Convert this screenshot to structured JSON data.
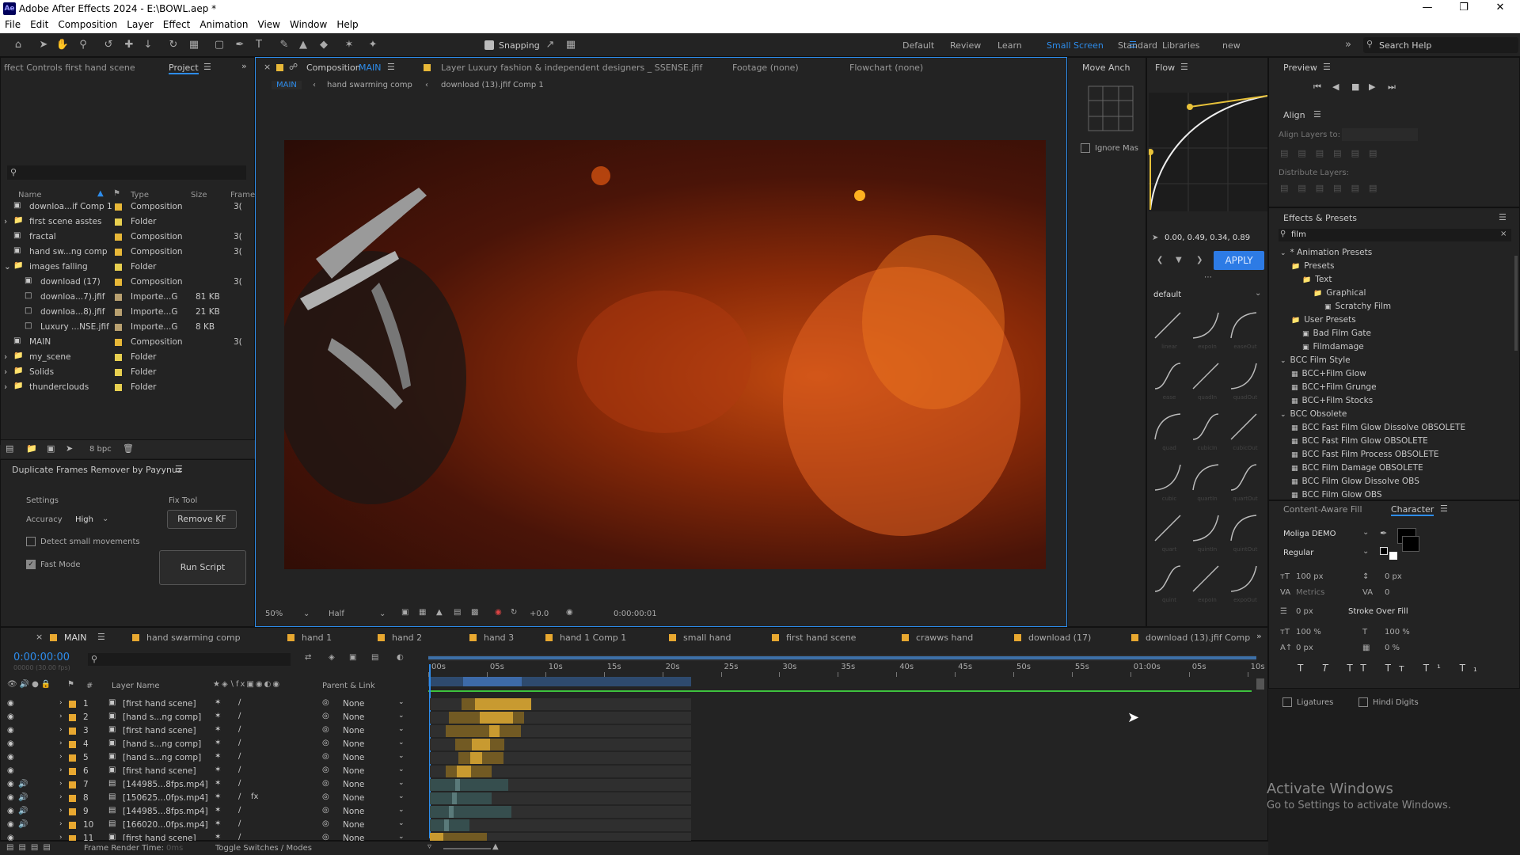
{
  "app": {
    "title": "Adobe After Effects 2024 - E:\\BOWL.aep *",
    "logo": "Ae"
  },
  "menu": [
    "File",
    "Edit",
    "Composition",
    "Layer",
    "Effect",
    "Animation",
    "View",
    "Window",
    "Help"
  ],
  "toolbar": {
    "snapping": "Snapping",
    "workspaces": [
      "Default",
      "Review",
      "Learn",
      "Small Screen",
      "Standard",
      "Libraries",
      "new"
    ],
    "active_workspace": "Small Screen",
    "search_placeholder": "Search Help"
  },
  "project": {
    "effect_controls_tab": "ffect Controls first hand scene",
    "project_tab": "Project",
    "columns": [
      "Name",
      "Type",
      "Size",
      "Frame"
    ],
    "items": [
      {
        "name": "downloa...if Comp 1",
        "type": "Composition",
        "size": "",
        "frame": "3(",
        "color": "#e8b838",
        "icon": "comp",
        "indent": 0,
        "twirl": ""
      },
      {
        "name": "first scene asstes",
        "type": "Folder",
        "size": "",
        "frame": "",
        "color": "#e8d050",
        "icon": "folder",
        "indent": 0,
        "twirl": "›"
      },
      {
        "name": "fractal",
        "type": "Composition",
        "size": "",
        "frame": "3(",
        "color": "#e8b838",
        "icon": "comp",
        "indent": 0,
        "twirl": ""
      },
      {
        "name": "hand sw...ng comp",
        "type": "Composition",
        "size": "",
        "frame": "3(",
        "color": "#e8b838",
        "icon": "comp",
        "indent": 0,
        "twirl": ""
      },
      {
        "name": "images falling",
        "type": "Folder",
        "size": "",
        "frame": "",
        "color": "#e8d050",
        "icon": "folder",
        "indent": 0,
        "twirl": "⌄"
      },
      {
        "name": "download (17)",
        "type": "Composition",
        "size": "",
        "frame": "3(",
        "color": "#e8b838",
        "icon": "comp",
        "indent": 1,
        "twirl": ""
      },
      {
        "name": "downloa...7).jfif",
        "type": "Importe...G",
        "size": "81 KB",
        "frame": "",
        "color": "#b8a070",
        "icon": "file",
        "indent": 1,
        "twirl": ""
      },
      {
        "name": "downloa...8).jfif",
        "type": "Importe...G",
        "size": "21 KB",
        "frame": "",
        "color": "#b8a070",
        "icon": "file",
        "indent": 1,
        "twirl": ""
      },
      {
        "name": "Luxury ...NSE.jfif",
        "type": "Importe...G",
        "size": "8 KB",
        "frame": "",
        "color": "#b8a070",
        "icon": "file",
        "indent": 1,
        "twirl": ""
      },
      {
        "name": "MAIN",
        "type": "Composition",
        "size": "",
        "frame": "3(",
        "color": "#e8b838",
        "icon": "comp",
        "indent": 0,
        "twirl": ""
      },
      {
        "name": "my_scene",
        "type": "Folder",
        "size": "",
        "frame": "",
        "color": "#e8d050",
        "icon": "folder",
        "indent": 0,
        "twirl": "›"
      },
      {
        "name": "Solids",
        "type": "Folder",
        "size": "",
        "frame": "",
        "color": "#e8d050",
        "icon": "folder",
        "indent": 0,
        "twirl": "›"
      },
      {
        "name": "thunderclouds",
        "type": "Folder",
        "size": "",
        "frame": "",
        "color": "#e8d050",
        "icon": "folder",
        "indent": 0,
        "twirl": "›"
      }
    ],
    "bpc": "8 bpc"
  },
  "dup": {
    "title": "Duplicate Frames Remover by Payynuz",
    "settings": "Settings",
    "accuracy_label": "Accuracy",
    "accuracy_value": "High",
    "detect": "Detect small movements",
    "fast": "Fast Mode",
    "fix_tool": "Fix Tool",
    "remove_kf": "Remove KF",
    "run": "Run Script"
  },
  "comp": {
    "tab_label": "Composition",
    "tab_name": "MAIN",
    "layer_tab": "Layer  Luxury fashion & independent designers _ SSENSE.jfif",
    "footage_tab": "Footage (none)",
    "flowchart_tab": "Flowchart (none)",
    "breadcrumbs": [
      "MAIN",
      "hand swarming comp",
      "download (13).jfif Comp 1"
    ],
    "zoom": "50%",
    "resolution": "Half",
    "exposure": "+0.0",
    "timecode": "0:00:00:01"
  },
  "move_anchor": {
    "title": "Move Anch",
    "ignore": "Ignore Mas"
  },
  "flow": {
    "title": "Flow",
    "values": "0.00, 0.49, 0.34, 0.89",
    "apply": "APPLY",
    "preset": "default",
    "curves": [
      "linear",
      "expoIn",
      "easeOut",
      "ease",
      "quadIn",
      "quadOut",
      "quad",
      "cubicIn",
      "cubicOut",
      "cubic",
      "quartIn",
      "quartOut",
      "quart",
      "quintIn",
      "quintOut",
      "quint",
      "expoIn",
      "expoOut"
    ]
  },
  "preview": {
    "title": "Preview"
  },
  "align": {
    "title": "Align",
    "align_to": "Align Layers to:",
    "distribute": "Distribute Layers:"
  },
  "effects": {
    "title": "Effects & Presets",
    "search": "film",
    "tree": [
      {
        "t": "* Animation Presets",
        "d": 0,
        "k": "tw"
      },
      {
        "t": "Presets",
        "d": 1,
        "k": "folder"
      },
      {
        "t": "Text",
        "d": 2,
        "k": "folder"
      },
      {
        "t": "Graphical",
        "d": 3,
        "k": "folder"
      },
      {
        "t": "Scratchy Film",
        "d": 4,
        "k": "item"
      },
      {
        "t": "User Presets",
        "d": 1,
        "k": "folder"
      },
      {
        "t": "Bad Film Gate",
        "d": 2,
        "k": "item"
      },
      {
        "t": "Filmdamage",
        "d": 2,
        "k": "item"
      },
      {
        "t": "BCC Film Style",
        "d": 0,
        "k": "tw"
      },
      {
        "t": "BCC+Film Glow",
        "d": 1,
        "k": "fx"
      },
      {
        "t": "BCC+Film Grunge",
        "d": 1,
        "k": "fx"
      },
      {
        "t": "BCC+Film Stocks",
        "d": 1,
        "k": "fx"
      },
      {
        "t": "BCC Obsolete",
        "d": 0,
        "k": "tw"
      },
      {
        "t": "BCC Fast Film Glow Dissolve OBSOLETE",
        "d": 1,
        "k": "fx"
      },
      {
        "t": "BCC Fast Film Glow OBSOLETE",
        "d": 1,
        "k": "fx"
      },
      {
        "t": "BCC Fast Film Process OBSOLETE",
        "d": 1,
        "k": "fx"
      },
      {
        "t": "BCC Film Damage OBSOLETE",
        "d": 1,
        "k": "fx"
      },
      {
        "t": "BCC Film Glow Dissolve OBS",
        "d": 1,
        "k": "fx"
      },
      {
        "t": "BCC Film Glow OBS",
        "d": 1,
        "k": "fx"
      }
    ]
  },
  "character": {
    "caf_tab": "Content-Aware Fill",
    "title": "Character",
    "font": "Moliga DEMO",
    "style": "Regular",
    "size": "100 px",
    "leading": "0 px",
    "kerning": "Metrics",
    "tracking": "0",
    "stroke_width": "0 px",
    "stroke_mode": "Stroke Over Fill",
    "vscale": "100 %",
    "hscale": "100 %",
    "baseline": "0 px",
    "tsume": "0 %",
    "ligatures": "Ligatures",
    "hindi": "Hindi Digits"
  },
  "timeline": {
    "tabs": [
      "MAIN",
      "hand swarming comp",
      "hand 1",
      "hand 2",
      "hand 3",
      "hand 1  Comp 1",
      "small hand",
      "first hand scene",
      "crawws hand",
      "download (17)",
      "download (13).jfif Comp"
    ],
    "timecode": "0:00:00:00",
    "fps": "00000 (30.00 fps)",
    "col_layer": "Layer Name",
    "col_parent": "Parent & Link",
    "ruler": [
      "00s",
      "05s",
      "10s",
      "15s",
      "20s",
      "25s",
      "30s",
      "35s",
      "40s",
      "45s",
      "50s",
      "55s",
      "01:00s",
      "05s",
      "10s"
    ],
    "layers": [
      {
        "n": "1",
        "name": "[first hand scene]",
        "type": "comp",
        "parent": "None",
        "bs": 0.1,
        "be": 0.315,
        "fs": 0.145,
        "fe": 0.315,
        "clr": "#8a6a20"
      },
      {
        "n": "2",
        "name": "[hand s...ng comp]",
        "type": "comp",
        "parent": "None",
        "bs": 0.06,
        "be": 0.29,
        "fs": 0.16,
        "fe": 0.26,
        "clr": "#8a6a20"
      },
      {
        "n": "3",
        "name": "[first hand scene]",
        "type": "comp",
        "parent": "None",
        "bs": 0.05,
        "be": 0.28,
        "fs": 0.19,
        "fe": 0.22,
        "clr": "#8a6a20"
      },
      {
        "n": "4",
        "name": "[hand s...ng comp]",
        "type": "comp",
        "parent": "None",
        "bs": 0.08,
        "be": 0.23,
        "fs": 0.135,
        "fe": 0.19,
        "clr": "#8a6a20"
      },
      {
        "n": "5",
        "name": "[hand s...ng comp]",
        "type": "comp",
        "parent": "None",
        "bs": 0.09,
        "be": 0.23,
        "fs": 0.13,
        "fe": 0.165,
        "clr": "#8a6a20"
      },
      {
        "n": "6",
        "name": "[first hand scene]",
        "type": "comp",
        "parent": "None",
        "bs": 0.05,
        "be": 0.19,
        "fs": 0.085,
        "fe": 0.13,
        "clr": "#8a6a20"
      },
      {
        "n": "7",
        "name": "[144985...8fps.mp4]",
        "type": "video",
        "parent": "None",
        "bs": 0.0,
        "be": 0.24,
        "fs": 0.08,
        "fe": 0.087,
        "clr": "#3a5a5a"
      },
      {
        "n": "8",
        "name": "[150625...0fps.mp4]",
        "type": "video",
        "parent": "None",
        "bs": 0.0,
        "be": 0.19,
        "fs": 0.07,
        "fe": 0.077,
        "clr": "#3a5a5a"
      },
      {
        "n": "9",
        "name": "[144985...8fps.mp4]",
        "type": "video",
        "parent": "None",
        "bs": 0.0,
        "be": 0.25,
        "fs": 0.06,
        "fe": 0.069,
        "clr": "#3a5a5a"
      },
      {
        "n": "10",
        "name": "[166020...0fps.mp4]",
        "type": "video",
        "parent": "None",
        "bs": 0.0,
        "be": 0.12,
        "fs": 0.045,
        "fe": 0.055,
        "clr": "#3a5a5a"
      },
      {
        "n": "11",
        "name": "[first hand scene]",
        "type": "comp",
        "parent": "None",
        "bs": 0.0,
        "be": 0.175,
        "fs": 0.0,
        "fe": 0.04,
        "clr": "#8a6a20"
      }
    ],
    "frame_render": "Frame Render Time:",
    "frame_render_val": "0ms",
    "toggle": "Toggle Switches / Modes"
  },
  "watermark": {
    "line1": "Activate Windows",
    "line2": "Go to Settings to activate Windows."
  }
}
